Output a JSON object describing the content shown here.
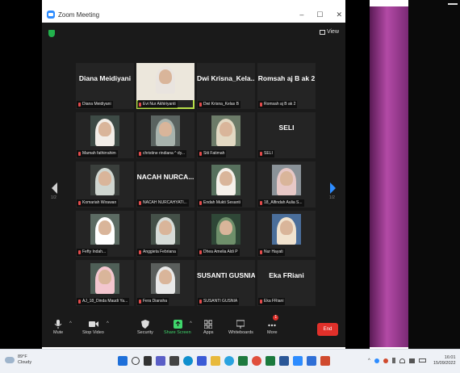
{
  "window": {
    "title": "Zoom Meeting",
    "controls": [
      "–",
      "☐",
      "✕"
    ]
  },
  "topbar": {
    "view_label": "View"
  },
  "page_indicator_left": "1/2",
  "page_indicator_right": "1/2",
  "tiles": [
    {
      "display": "Diana Meidiyani",
      "label": "Diana Meidiyani"
    },
    {
      "display": "",
      "label": "Evi Nur Akhiriyanti",
      "video": true,
      "active": true
    },
    {
      "display": "Dwi Krisna_Kela...",
      "label": "Dwi Krisna_Kelas B"
    },
    {
      "display": "Romsah aj  B ak 2",
      "label": "Romsah aj  B ak 2"
    },
    {
      "display": "",
      "label": "Mamah fathirrahim",
      "video": true
    },
    {
      "display": "",
      "label": "christine rindiana ^ dy...",
      "video": true
    },
    {
      "display": "",
      "label": "Siti Fatimah",
      "video": true
    },
    {
      "display": "SELI",
      "label": "SELI"
    },
    {
      "display": "",
      "label": "Komariah Wirawan",
      "video": true
    },
    {
      "display": "NACAH NURCA...",
      "label": "NACAH NURCAHYATI..."
    },
    {
      "display": "",
      "label": "Endah Mukti Sesanti",
      "video": true
    },
    {
      "display": "",
      "label": "18_Alfindah Aulia S...",
      "video": true
    },
    {
      "display": "",
      "label": "Fefty Indah...",
      "video": true
    },
    {
      "display": "",
      "label": "Anggieta Febriana",
      "video": true
    },
    {
      "display": "",
      "label": "Dhea Amelia Aldi P",
      "video": true
    },
    {
      "display": "",
      "label": "Nur Hayati",
      "video": true
    },
    {
      "display": "",
      "label": "AJ_18_Dinda Maudi Ya...",
      "video": true
    },
    {
      "display": "",
      "label": "Fera Diansha",
      "video": true
    },
    {
      "display": "SUSANTI GUSNIA",
      "label": "SUSANTI GUSNIA"
    },
    {
      "display": "Eka FRiani",
      "label": "Eka FRiani"
    }
  ],
  "toolbar": {
    "mute": "Mute",
    "stop_video": "Stop Video",
    "security": "Security",
    "share_screen": "Share Screen",
    "apps": "Apps",
    "whiteboards": "Whiteboards",
    "more": "More",
    "more_badge": "1",
    "end": "End"
  },
  "taskbar": {
    "temperature": "89°F",
    "weather": "Cloudy",
    "time": "16:01",
    "date": "15/09/2022"
  },
  "colors": {
    "accent": "#2d8cff",
    "active_border": "#b8e04a",
    "end": "#e0302a",
    "share": "#3fd66b"
  }
}
